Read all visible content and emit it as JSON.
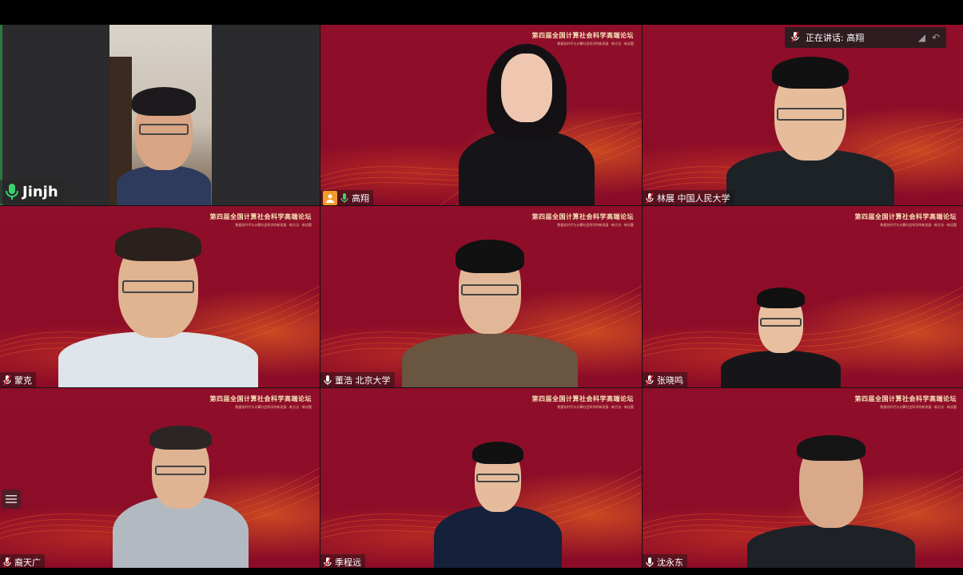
{
  "meeting": {
    "speaking_indicator": {
      "label": "正在讲话: 高翔",
      "mic_icon": "mic-muted-icon",
      "controls": [
        "expand-icon",
        "reply-icon"
      ]
    },
    "banner": {
      "title": "第四届全国计算社会科学高端论坛",
      "subtitle": "数据化时代与计算社会科学的新发展 · 新方法 · 新议题"
    },
    "participants": [
      {
        "name": "Jinjh",
        "mic": "active",
        "has_video": true,
        "has_banner": false
      },
      {
        "name": "高翔",
        "mic": "active",
        "host_badge": true,
        "has_banner": true
      },
      {
        "name": "林展 中国人民大学",
        "mic": "muted",
        "has_banner": true
      },
      {
        "name": "蒙克",
        "mic": "muted",
        "has_banner": true
      },
      {
        "name": "董浩 北京大学",
        "mic": "active",
        "has_banner": true
      },
      {
        "name": "张晓鸣",
        "mic": "muted",
        "has_banner": true
      },
      {
        "name": "裔天广",
        "mic": "muted",
        "has_banner": true
      },
      {
        "name": "季程远",
        "mic": "muted",
        "has_banner": true
      },
      {
        "name": "沈永东",
        "mic": "active",
        "has_banner": true
      }
    ],
    "colors": {
      "background_red": "#8b0c27",
      "wave_orange": "#ff6a1a",
      "mic_active_green": "#3bd16f",
      "host_badge_orange": "#f39a2b"
    }
  }
}
